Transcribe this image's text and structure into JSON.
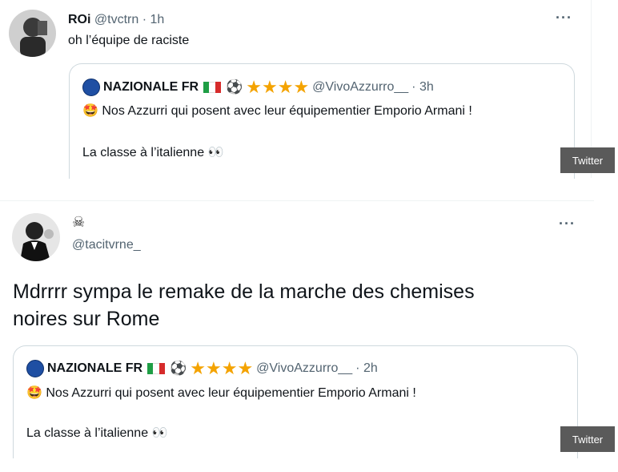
{
  "tweet1": {
    "name": "ROi",
    "handle": "@tvctrn",
    "time": "· 1h",
    "text": "oh l’équipe de raciste",
    "more": "···",
    "quote": {
      "name": "NAZIONALE FR",
      "handle": "@VivoAzzurro__",
      "time": "· 3h",
      "line1": "Nos Azzurri qui posent avec leur équipementier Emporio Armani !",
      "line2": "La classe à l’italienne 👀"
    },
    "badge": "Twitter"
  },
  "tweet2": {
    "name": "☠",
    "handle": "@tacitvrne_",
    "more": "···",
    "text_line1": "Mdrrrr sympa le remake de la marche des chemises",
    "text_line2": "noires sur Rome",
    "quote": {
      "name": "NAZIONALE FR",
      "handle": "@VivoAzzurro__",
      "time": "· 2h",
      "line1": "Nos Azzurri qui posent avec leur équipementier Emporio Armani !",
      "line2": "La classe à l’italienne 👀"
    },
    "badge": "Twitter"
  },
  "decor": {
    "stars": "★★★★",
    "ball": "⚽",
    "smiley": "🤩"
  },
  "colors": {
    "secondary_text": "#536471",
    "star": "#f4a300",
    "border": "#cfd9de"
  }
}
